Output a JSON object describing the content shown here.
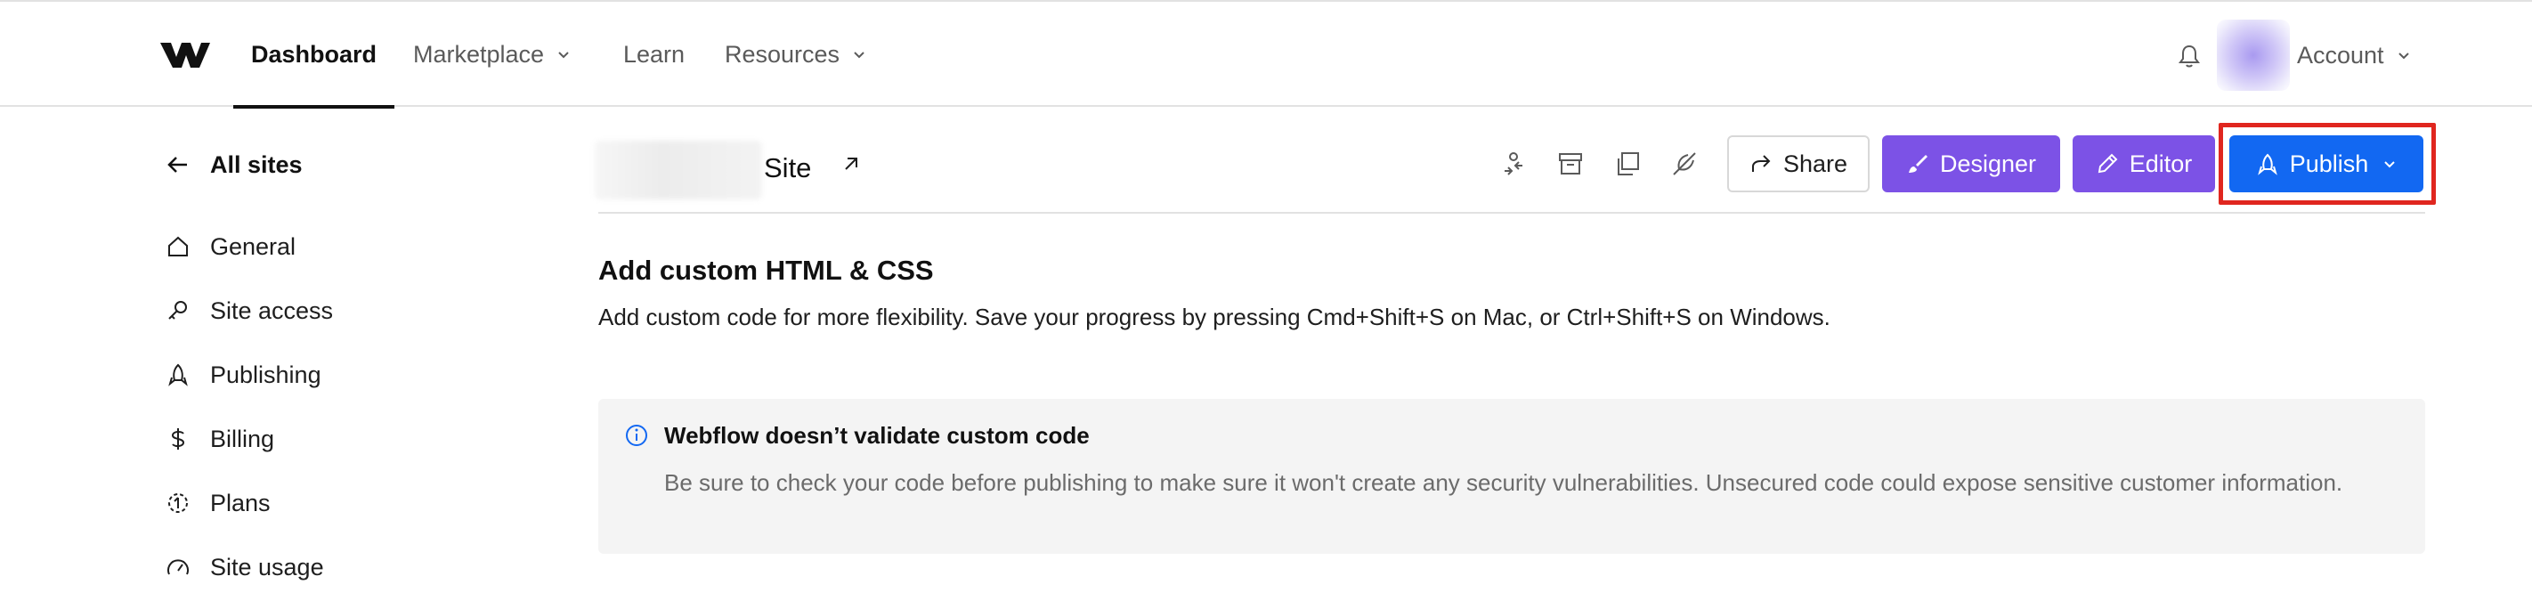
{
  "colors": {
    "accent_purple": "#7c52e6",
    "publish_blue": "#1268f2",
    "highlight_red": "#e0261f",
    "callout_bg": "#f4f4f4"
  },
  "nav": {
    "tabs": [
      {
        "label": "Dashboard",
        "active": true
      },
      {
        "label": "Marketplace",
        "has_dropdown": true
      },
      {
        "label": "Learn"
      },
      {
        "label": "Resources",
        "has_dropdown": true
      }
    ],
    "account_label": "Account",
    "icons": [
      "webflow-logo-icon",
      "bell-icon",
      "chevron-down-icon"
    ]
  },
  "sidebar": {
    "back_label": "All sites",
    "items": [
      {
        "label": "General",
        "icon": "home-icon"
      },
      {
        "label": "Site access",
        "icon": "key-icon"
      },
      {
        "label": "Publishing",
        "icon": "rocket-icon"
      },
      {
        "label": "Billing",
        "icon": "dollar-icon"
      },
      {
        "label": "Plans",
        "icon": "plans-icon"
      },
      {
        "label": "Site usage",
        "icon": "gauge-icon"
      }
    ]
  },
  "header": {
    "site_title": "Site",
    "tool_icons": [
      "transfer-icon",
      "archive-icon",
      "duplicate-icon",
      "unpin-icon"
    ],
    "buttons": {
      "share": "Share",
      "designer": "Designer",
      "editor": "Editor",
      "publish": "Publish"
    }
  },
  "content": {
    "title": "Add custom HTML & CSS",
    "description": "Add custom code for more flexibility. Save your progress by pressing Cmd+Shift+S on Mac, or Ctrl+Shift+S on Windows.",
    "callout": {
      "title": "Webflow doesn’t validate custom code",
      "body": "Be sure to check your code before publishing to make sure it won't create any security vulnerabilities. Unsecured code could expose sensitive customer information."
    }
  }
}
